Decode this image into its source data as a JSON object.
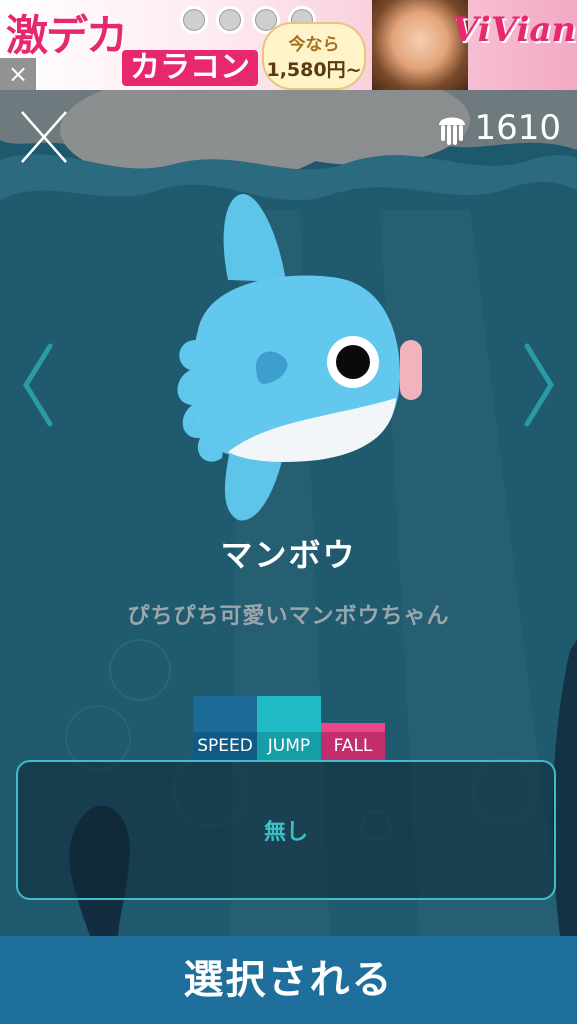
{
  "ad": {
    "headline": "激デカ",
    "subline": "カラコン",
    "badge_line1": "今なら",
    "badge_line2": "1,580円~",
    "logo": "ViVian",
    "close_label": "×"
  },
  "header": {
    "coin_count": "1610",
    "coin_icon": "jellyfish-icon",
    "close_icon": "close-icon"
  },
  "character": {
    "name": "マンボウ",
    "description": "ぴちぴち可愛いマンボウちゃん",
    "stats": [
      {
        "label": "SPEED",
        "level": 1.0,
        "color": "#1b6a98",
        "label_bg": "#125a86"
      },
      {
        "label": "JUMP",
        "level": 1.0,
        "color": "#1fbcc6",
        "label_bg": "#169da6"
      },
      {
        "label": "FALL",
        "level": 0.25,
        "color": "#e8458a",
        "label_bg": "#c22e6c"
      }
    ]
  },
  "ability": {
    "text": "無し"
  },
  "select_button": {
    "label": "選択される"
  },
  "colors": {
    "accent": "#3bbfc9",
    "button": "#1e6f9c",
    "fish": "#63c8ee"
  }
}
